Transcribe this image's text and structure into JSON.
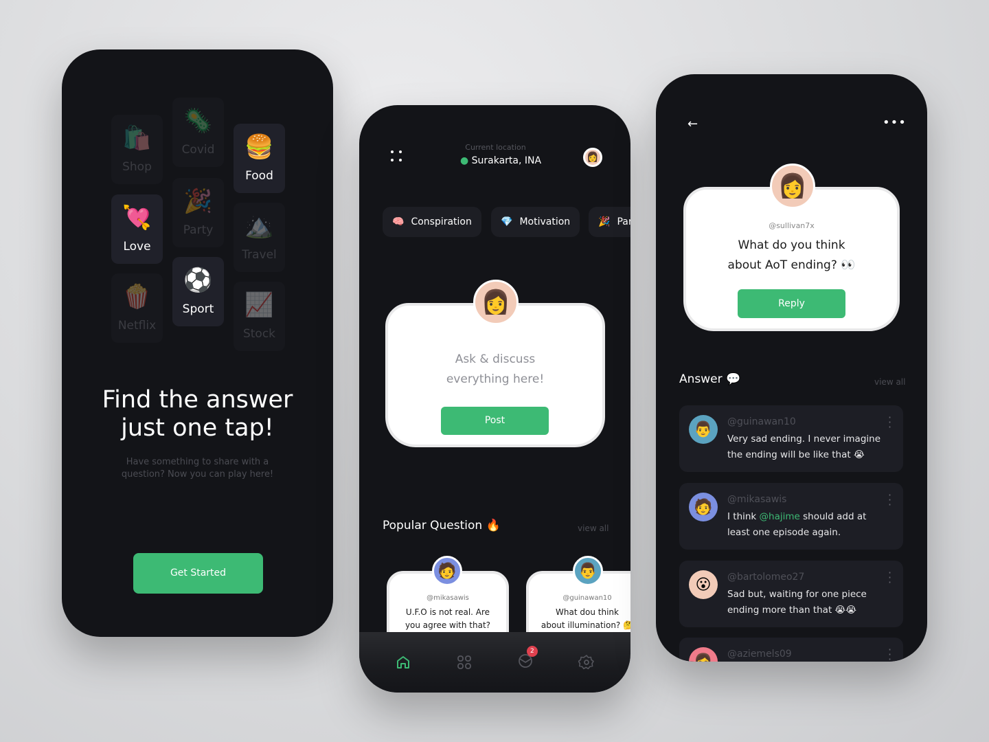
{
  "onboarding": {
    "categories": [
      {
        "label": "Shop",
        "emoji": "🛍️",
        "active": false
      },
      {
        "label": "Covid",
        "emoji": "🦠",
        "active": false
      },
      {
        "label": "Food",
        "emoji": "🍔",
        "active": true
      },
      {
        "label": "Love",
        "emoji": "💘",
        "active": true
      },
      {
        "label": "Party",
        "emoji": "🎉",
        "active": false
      },
      {
        "label": "Travel",
        "emoji": "🏔️",
        "active": false
      },
      {
        "label": "Netflix",
        "emoji": "🍿",
        "active": false
      },
      {
        "label": "Sport",
        "emoji": "⚽",
        "active": true
      },
      {
        "label": "Stock",
        "emoji": "📈",
        "active": false
      }
    ],
    "title_line1": "Find the answer",
    "title_line2": "just one tap!",
    "subtitle_line1": "Have something to share with a",
    "subtitle_line2": "question? Now you can play here!",
    "cta": "Get Started"
  },
  "home": {
    "location_label": "Current location",
    "location": "Surakarta, INA",
    "chips": [
      {
        "emoji": "🧠",
        "label": "Conspiration"
      },
      {
        "emoji": "💎",
        "label": "Motivation"
      },
      {
        "emoji": "🎉",
        "label": "Party"
      }
    ],
    "ask_line1": "Ask & discuss",
    "ask_line2": "everything here!",
    "post": "Post",
    "popular_title": "Popular Question 🔥",
    "view_all": "view all",
    "questions": [
      {
        "user": "@mikasawis",
        "line1": "U.F.O is not real. Are",
        "line2": "you agree with that?",
        "emoji": "🧑‍🦰",
        "color": "#7b8fe0"
      },
      {
        "user": "@guinawan10",
        "line1": "What dou think",
        "line2": "about illumination? 🤔",
        "emoji": "👨",
        "color": "#5ba3c0"
      }
    ],
    "nav": [
      {
        "icon": "home-icon",
        "active": true
      },
      {
        "icon": "grid-icon"
      },
      {
        "icon": "messages-icon",
        "badge": "2"
      },
      {
        "icon": "settings-icon"
      }
    ],
    "accent": "#3dba74"
  },
  "detail": {
    "user": "@sullivan7x",
    "question_line1": "What do you think",
    "question_line2": "about AoT ending? 👀",
    "reply": "Reply",
    "answer_title": "Answer 💬",
    "view_all": "view all",
    "answers": [
      {
        "user": "@guinawan10",
        "text": "Very sad ending. I never imagine the ending will be like that 😭",
        "color": "#5ba3c0",
        "emoji": "👨"
      },
      {
        "user": "@mikasawis",
        "text_pre": "I think ",
        "mention": "@hajime",
        "text_post": " should add at least one episode again.",
        "color": "#7b8fe0",
        "emoji": "🧑‍🦰"
      },
      {
        "user": "@bartolomeo27",
        "text": "Sad but, waiting for one piece ending more than that 😭😭",
        "color": "#f2cbb8",
        "emoji": "😮"
      },
      {
        "user": "@aziemels09",
        "text": "",
        "color": "#f07b8a",
        "emoji": "👩"
      }
    ]
  }
}
